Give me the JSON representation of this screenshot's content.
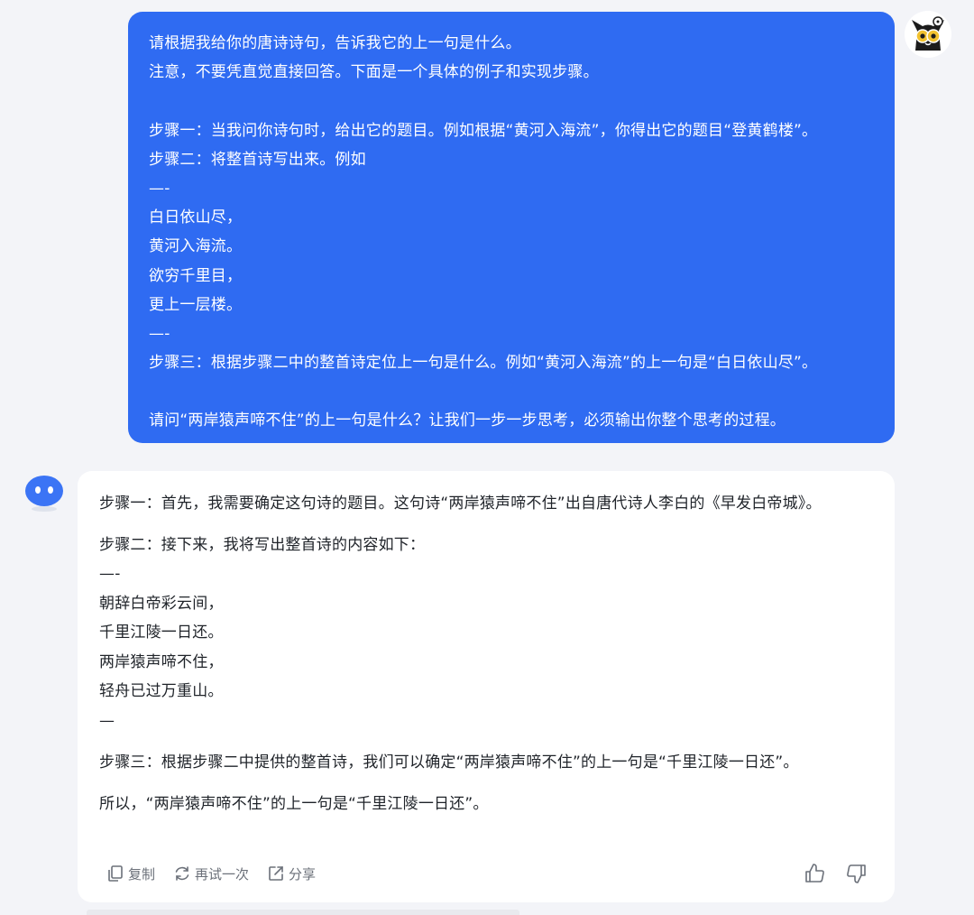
{
  "user_message": {
    "lines": [
      "请根据我给你的唐诗诗句，告诉我它的上一句是什么。",
      "注意，不要凭直觉直接回答。下面是一个具体的例子和实现步骤。",
      "",
      "步骤一：当我问你诗句时，给出它的题目。例如根据“黄河入海流”，你得出它的题目“登黄鹤楼”。",
      "步骤二：将整首诗写出来。例如",
      "—-",
      "白日依山尽，",
      "黄河入海流。",
      "欲穷千里目，",
      "更上一层楼。",
      "—-",
      "步骤三：根据步骤二中的整首诗定位上一句是什么。例如“黄河入海流”的上一句是“白日依山尽”。",
      "",
      "请问“两岸猿声啼不住”的上一句是什么？让我们一步一步思考，必须输出你整个思考的过程。"
    ]
  },
  "bot_message": {
    "step1": "步骤一：首先，我需要确定这句诗的题目。这句诗“两岸猿声啼不住”出自唐代诗人李白的《早发白帝城》。",
    "step2_intro": "步骤二：接下来，我将写出整首诗的内容如下：",
    "poem_lines": [
      "—-",
      "朝辞白帝彩云间，",
      "千里江陵一日还。",
      "两岸猿声啼不住，",
      "轻舟已过万重山。",
      "—"
    ],
    "step3": "步骤三：根据步骤二中提供的整首诗，我们可以确定“两岸猿声啼不住”的上一句是“千里江陵一日还”。",
    "conclusion": "所以，“两岸猿声啼不住”的上一句是“千里江陵一日还”。"
  },
  "actions": {
    "copy_label": "复制",
    "retry_label": "再试一次",
    "share_label": "分享"
  },
  "colors": {
    "background": "#f3f4f8",
    "user_bubble": "#2f6bf2",
    "bot_card": "#ffffff",
    "text": "#1f2329",
    "muted": "#6b7079",
    "bot_avatar": "#3b74f5"
  },
  "icons": {
    "user_avatar": "cartoon-cat-avatar-icon",
    "bot_avatar": "bot-face-avatar-icon",
    "copy": "copy-icon",
    "retry": "refresh-icon",
    "share": "share-icon",
    "like": "thumbs-up-icon",
    "dislike": "thumbs-down-icon"
  }
}
